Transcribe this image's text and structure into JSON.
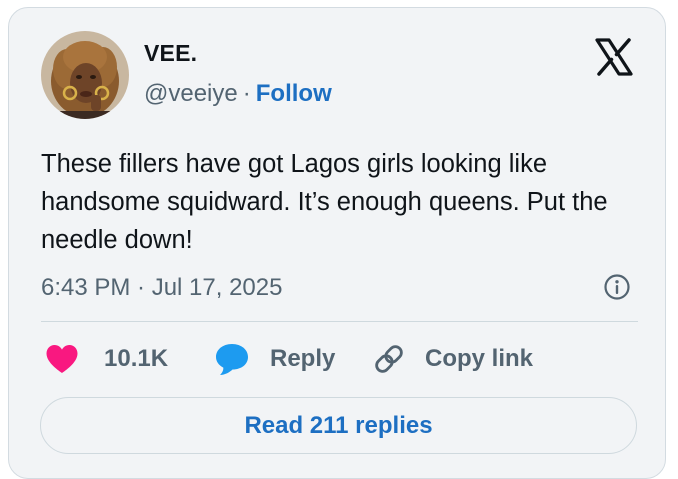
{
  "author": {
    "name": "VEE.",
    "handle": "@veeiye",
    "separator": "·",
    "follow_label": "Follow"
  },
  "tweet": {
    "text": "These fillers have got Lagos girls looking like handsome squidward. It’s enough queens. Put the needle down!",
    "timestamp": "6:43 PM · Jul 17, 2025"
  },
  "actions": {
    "like_count": "10.1K",
    "reply_label": "Reply",
    "copy_link_label": "Copy link"
  },
  "read_replies_label": "Read 211 replies",
  "icons": [
    "x-logo-icon",
    "info-icon",
    "heart-icon",
    "speech-bubble-icon",
    "link-icon"
  ],
  "colors": {
    "card_background": "#f2f4f6",
    "accent_blue": "#1d6fc2",
    "like_pink": "#f91880",
    "reply_blue": "#1d9bf0",
    "text_primary": "#0f1419",
    "text_secondary": "#536471"
  }
}
